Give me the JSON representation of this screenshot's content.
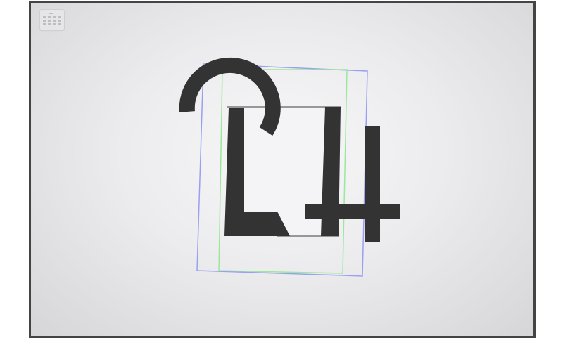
{
  "app": {
    "menu_icon": "grid-menu-icon"
  },
  "colors": {
    "piece": "#333333",
    "outline_blue": "#9aa0f0",
    "outline_green": "#9be89b",
    "target_fill": "#f3f3f5",
    "target_edge": "#7a7a7a"
  },
  "puzzle": {
    "glyphs": [
      "2",
      "L",
      "4"
    ]
  }
}
